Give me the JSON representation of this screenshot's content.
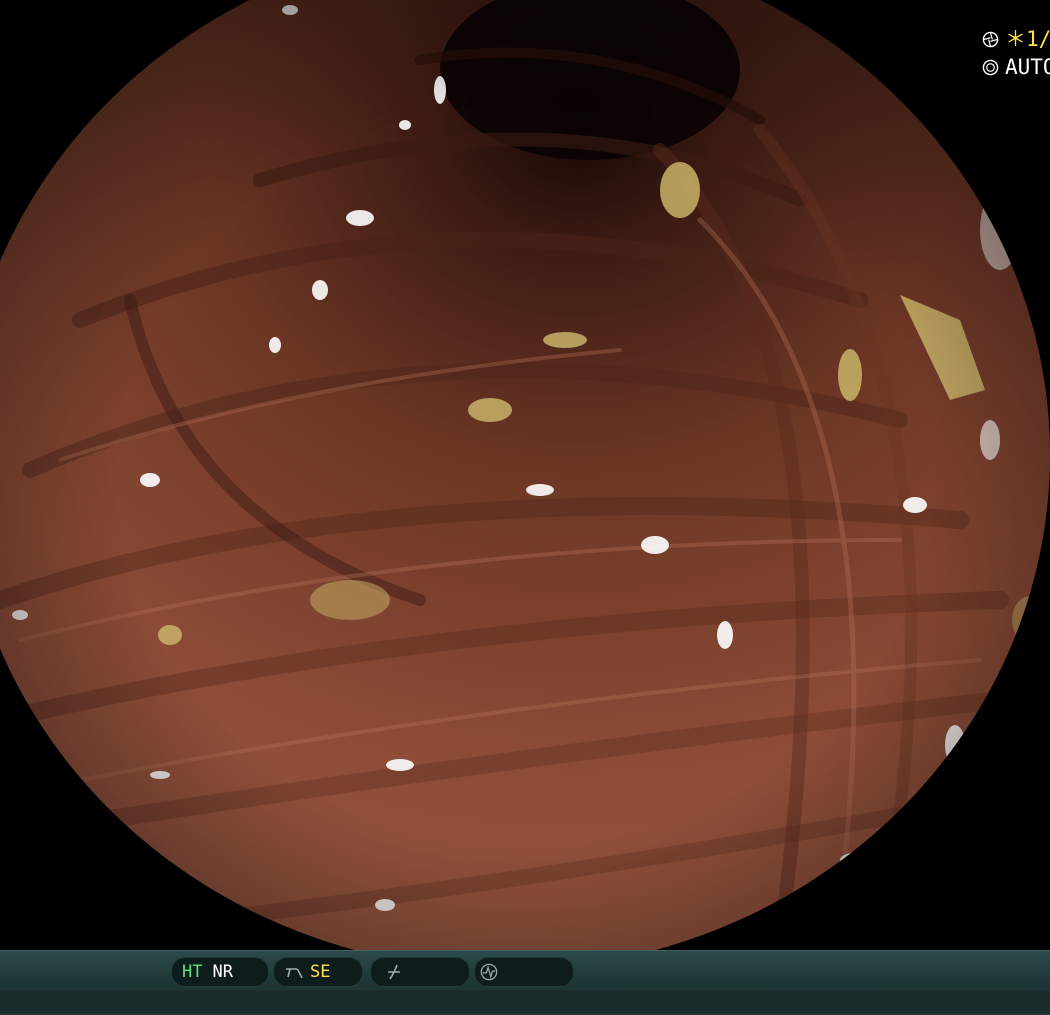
{
  "overlay": {
    "shutter_value": "＊1/",
    "mode_value": "AUTO",
    "shutter_icon": "shutter-icon",
    "mode_icon": "iris-mode-icon"
  },
  "status_bar": {
    "ht_label": "HT",
    "nr_label": "NR",
    "se_label": "SE",
    "icons": [
      "structure-enhance-icon",
      "color-enhance-icon",
      "waveform-icon"
    ],
    "colors": {
      "ht": "#5fe07a",
      "nr": "#ffffff",
      "se": "#ffe24a",
      "bar": "#1d3534"
    }
  }
}
